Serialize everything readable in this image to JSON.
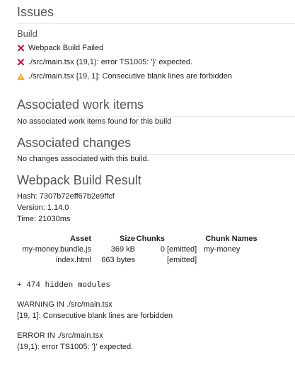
{
  "issues": {
    "title": "Issues",
    "group": "Build",
    "items": [
      {
        "type": "error",
        "text": "Webpack Build Failed"
      },
      {
        "type": "error",
        "text": "./src/main.tsx (19,1): error TS1005: '}' expected."
      },
      {
        "type": "warning",
        "text": "./src/main.tsx [19, 1]: Consecutive blank lines are forbidden"
      }
    ]
  },
  "work_items": {
    "title": "Associated work items",
    "empty_text": "No associated work items found for this build"
  },
  "changes": {
    "title": "Associated changes",
    "empty_text": "No changes associated with this build."
  },
  "result": {
    "title": "Webpack Build Result",
    "hash": "Hash: 7307b72eff67b2e9ffcf",
    "version": "Version: 1.14.0",
    "time": "Time: 21030ms",
    "table": {
      "headers": [
        "Asset",
        "Size",
        "Chunks",
        "",
        "Chunk Names"
      ],
      "rows": [
        [
          "my-money.bundle.js",
          "369 kB",
          "0",
          "[emitted]",
          "my-money"
        ],
        [
          "index.html",
          "663 bytes",
          "",
          "[emitted]",
          ""
        ]
      ]
    },
    "hidden_modules": "+ 474 hidden modules",
    "warning_header": "WARNING IN ./src/main.tsx",
    "warning_detail": "[19, 1]: Consecutive blank lines are forbidden",
    "error_header": "ERROR IN ./src/main.tsx",
    "error_detail": "(19,1): error TS1005: '}' expected."
  },
  "colors": {
    "error": "#c8102e",
    "warning": "#f5a623",
    "title": "#555555"
  }
}
